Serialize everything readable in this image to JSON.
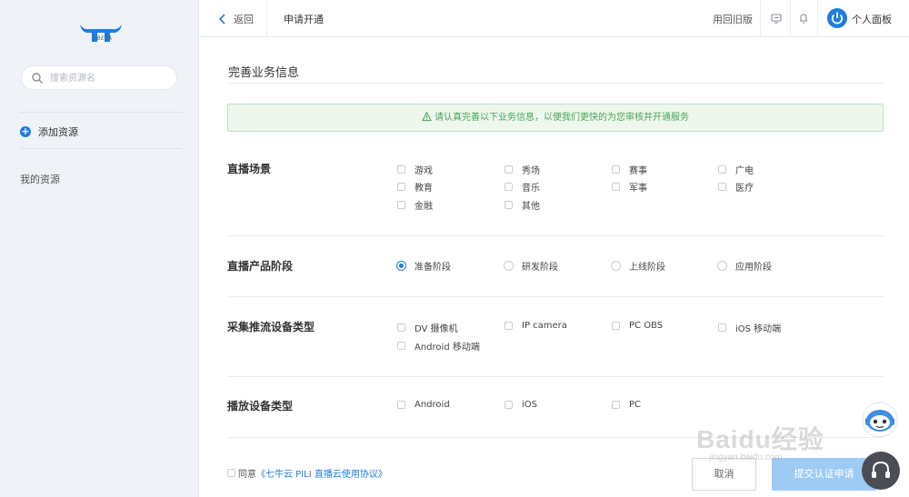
{
  "sidebar": {
    "logo_sub": ".BETA",
    "search_placeholder": "搜索资源名",
    "add_resource": "添加资源",
    "my_resources": "我的资源"
  },
  "topbar": {
    "back": "返回",
    "title": "申请开通",
    "old_version": "用回旧版",
    "profile": "个人面板"
  },
  "main": {
    "section_title": "完善业务信息",
    "notice": "请认真完善以下业务信息，以便我们更快的为您审核并开通服务",
    "live_scene": {
      "label": "直播场景",
      "options": [
        "游戏",
        "秀场",
        "赛事",
        "广电",
        "教育",
        "音乐",
        "军事",
        "医疗",
        "金融",
        "其他"
      ]
    },
    "product_stage": {
      "label": "直播产品阶段",
      "options": [
        "准备阶段",
        "研发阶段",
        "上线阶段",
        "应用阶段"
      ],
      "selected": "准备阶段"
    },
    "push_device": {
      "label": "采集推流设备类型",
      "options": [
        "DV 摄像机",
        "IP camera",
        "PC OBS",
        "iOS 移动端",
        "Android 移动端"
      ]
    },
    "play_device": {
      "label": "播放设备类型",
      "options": [
        "Android",
        "iOS",
        "PC"
      ]
    },
    "agree_prefix": "同意",
    "agree_link": "《七牛云 PILI 直播云使用协议》",
    "cancel": "取消",
    "submit": "提交认证申请"
  },
  "watermark": {
    "text": "Baidu经验",
    "sub": "jingyan.baidu.com"
  },
  "colors": {
    "accent": "#1d7de0",
    "sidebar_bg": "#eff2f7",
    "notice_bg": "#edf7ee",
    "notice_text": "#4aa454",
    "submit_bg": "#9ecbf4"
  }
}
